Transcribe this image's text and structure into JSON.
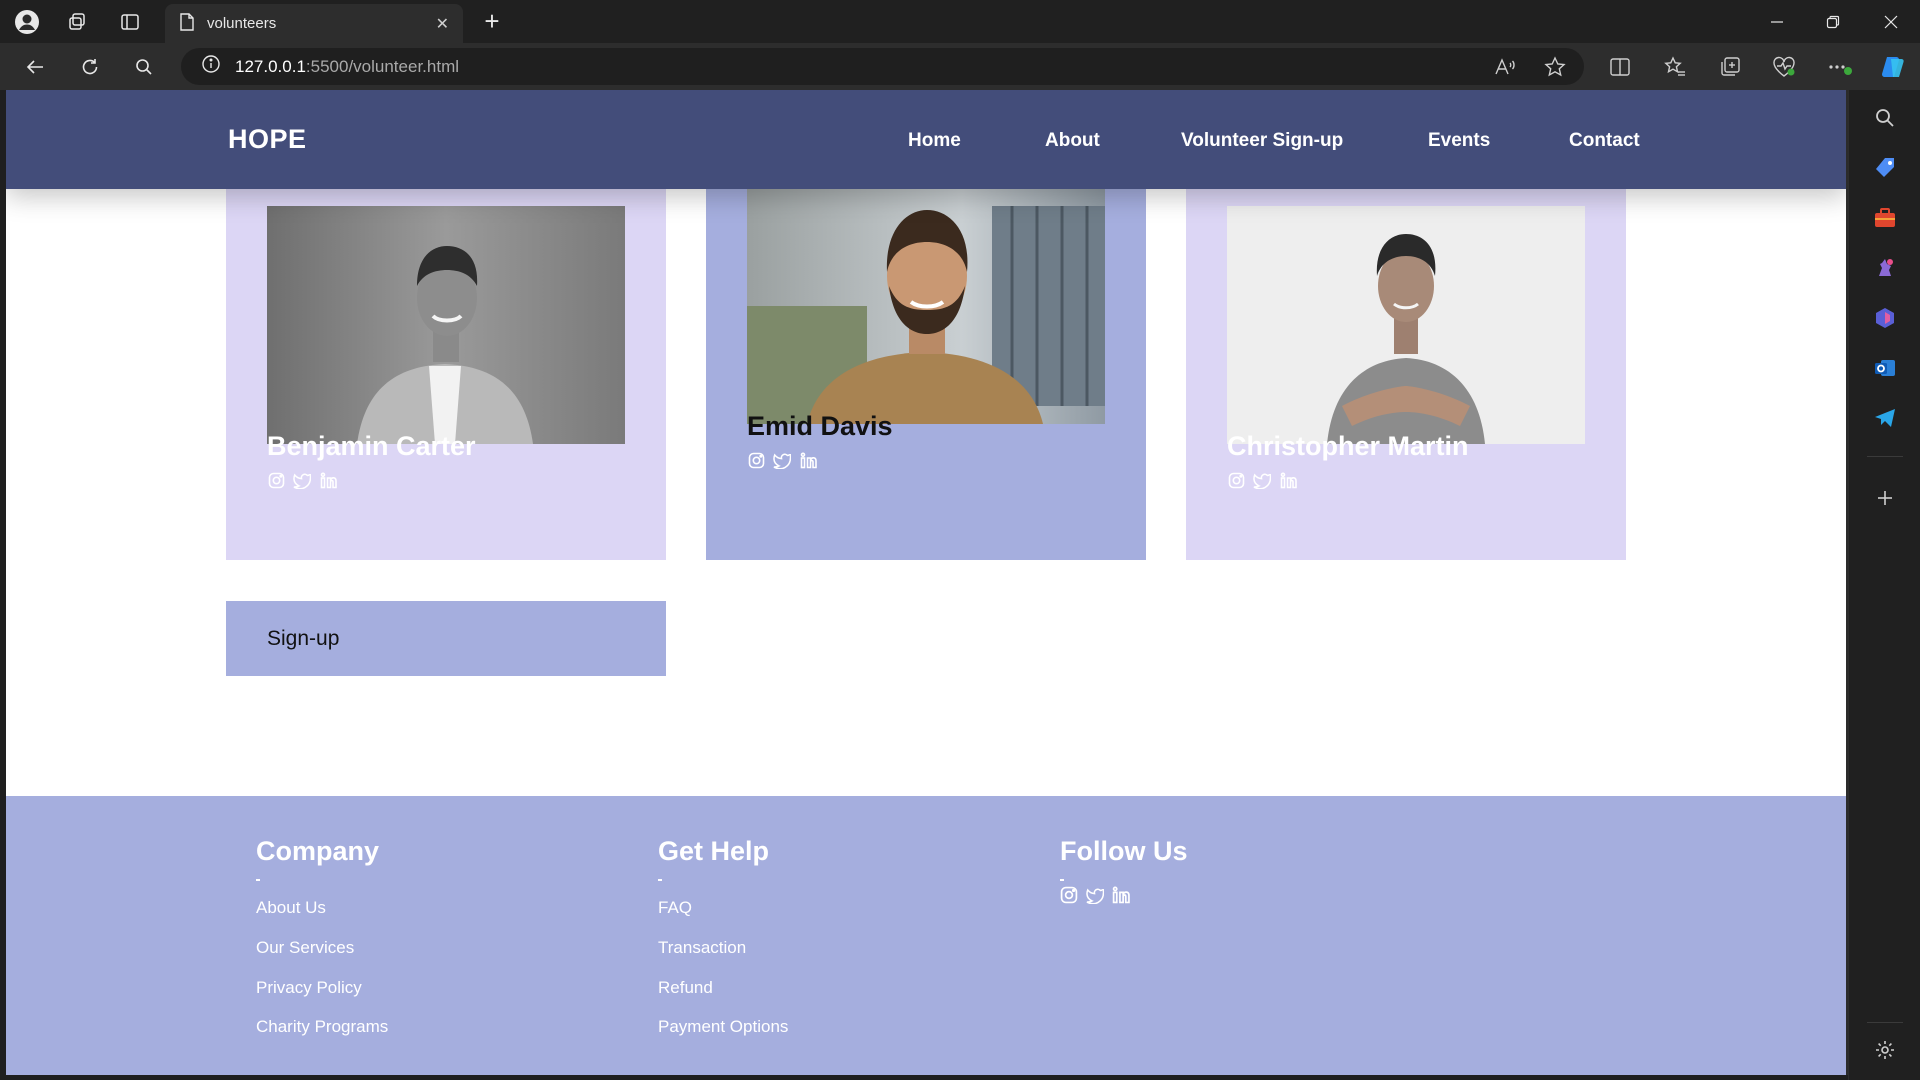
{
  "browser": {
    "tab_title": "volunteers",
    "url_host": "127.0.0.1",
    "url_path": ":5500/volunteer.html"
  },
  "site": {
    "logo": "HOPE",
    "nav": [
      "Home",
      "About",
      "Volunteer Sign-up",
      "Events",
      "Contact"
    ]
  },
  "volunteers": [
    {
      "name": "Benjamin Carter"
    },
    {
      "name": "Emid Davis"
    },
    {
      "name": "Christopher Martin"
    }
  ],
  "signup_label": "Sign-up",
  "footer": {
    "company": {
      "title": "Company",
      "links": [
        "About Us",
        "Our Services",
        "Privacy Policy",
        "Charity Programs"
      ]
    },
    "help": {
      "title": "Get Help",
      "links": [
        "FAQ",
        "Transaction",
        "Refund",
        "Payment Options"
      ]
    },
    "follow": {
      "title": "Follow Us"
    }
  },
  "colors": {
    "header": "#434d7a",
    "card": "#dcd6f5",
    "card_active": "#a5aede",
    "footer": "#a5aede"
  }
}
